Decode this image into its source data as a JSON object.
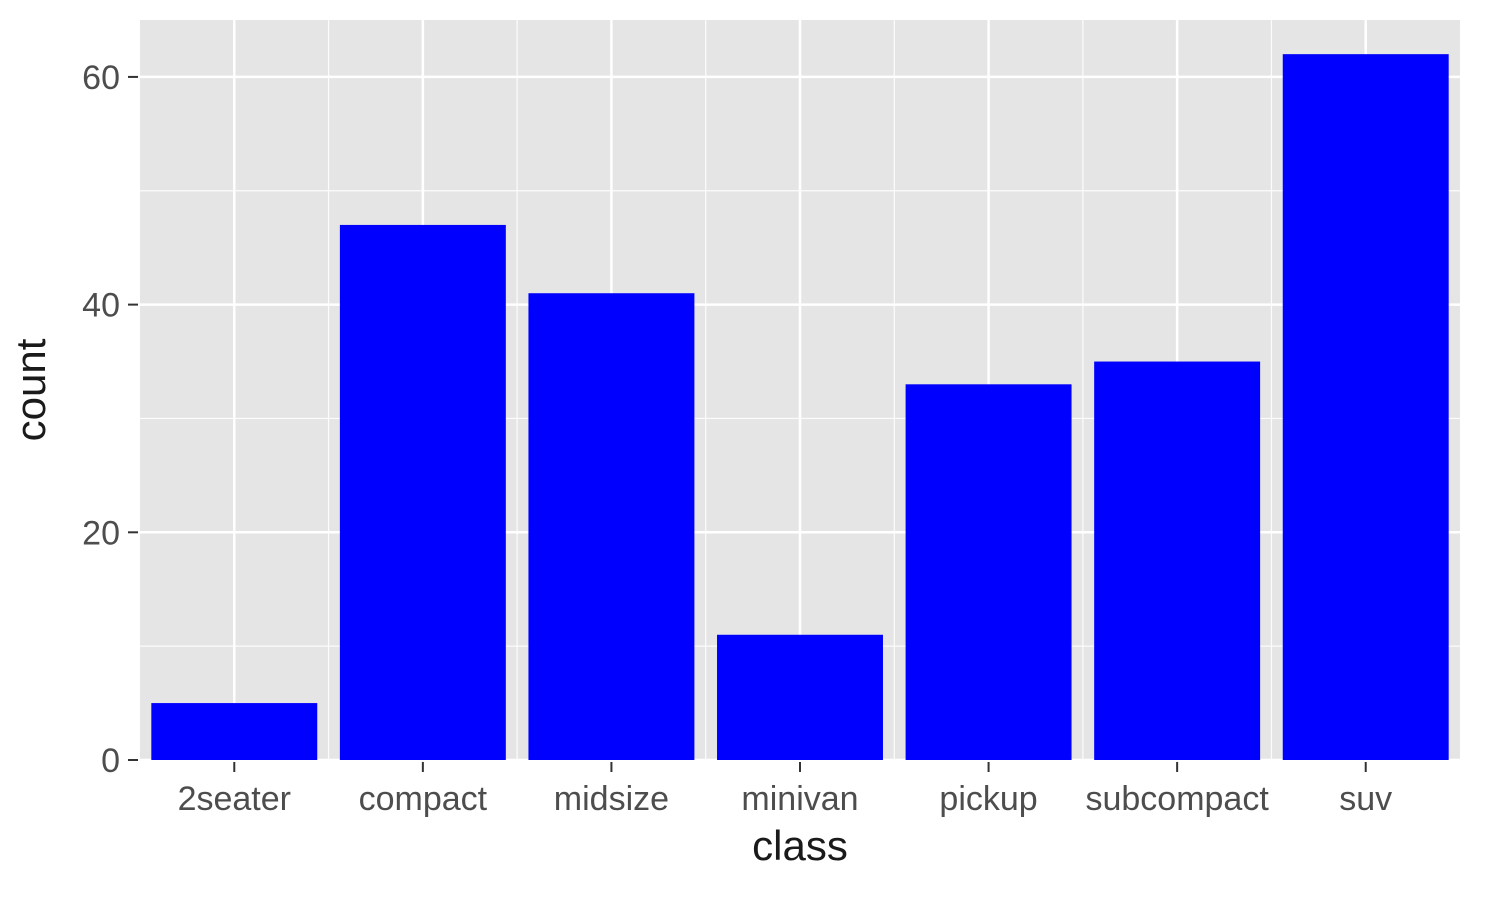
{
  "chart_data": {
    "type": "bar",
    "categories": [
      "2seater",
      "compact",
      "midsize",
      "minivan",
      "pickup",
      "subcompact",
      "suv"
    ],
    "values": [
      5,
      47,
      41,
      11,
      33,
      35,
      62
    ],
    "title": "",
    "xlabel": "class",
    "ylabel": "count",
    "ylim": [
      0,
      65
    ],
    "y_ticks": [
      0,
      20,
      40,
      60
    ],
    "y_minor": [
      10,
      30,
      50
    ],
    "bar_fill": "#0000FF",
    "panel_bg": "#E5E5E5",
    "grid_color": "#FFFFFF"
  }
}
